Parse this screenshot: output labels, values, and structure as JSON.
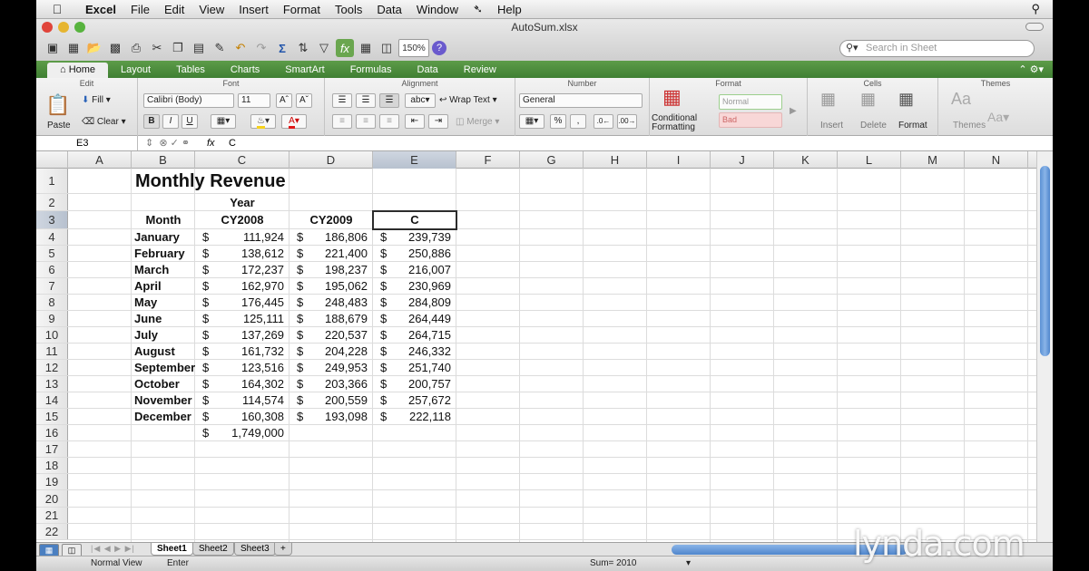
{
  "menubar": {
    "app": "Excel",
    "items": [
      "File",
      "Edit",
      "View",
      "Insert",
      "Format",
      "Tools",
      "Data",
      "Window",
      "Help"
    ]
  },
  "window": {
    "title": "AutoSum.xlsx",
    "zoom": "150%",
    "search_placeholder": "Search in Sheet"
  },
  "ribbon": {
    "tabs": [
      "Home",
      "Layout",
      "Tables",
      "Charts",
      "SmartArt",
      "Formulas",
      "Data",
      "Review"
    ],
    "groups": {
      "edit": "Edit",
      "font": "Font",
      "alignment": "Alignment",
      "number": "Number",
      "format": "Format",
      "cells": "Cells",
      "themes": "Themes"
    },
    "paste": "Paste",
    "fill": "Fill",
    "clear": "Clear",
    "font_name": "Calibri (Body)",
    "font_size": "11",
    "wrap_text": "Wrap Text",
    "merge": "Merge",
    "number_format": "General",
    "conditional": "Conditional",
    "formatting": "Formatting",
    "style_normal": "Normal",
    "style_bad": "Bad",
    "insert": "Insert",
    "delete": "Delete",
    "format_btn": "Format",
    "themes_btn": "Themes"
  },
  "formula_bar": {
    "cell_ref": "E3",
    "formula": "C"
  },
  "columns": [
    "A",
    "B",
    "C",
    "D",
    "E",
    "F",
    "G",
    "H",
    "I",
    "J",
    "K",
    "L",
    "M",
    "N"
  ],
  "rows": [
    "1",
    "2",
    "3",
    "4",
    "5",
    "6",
    "7",
    "8",
    "9",
    "10",
    "11",
    "12",
    "13",
    "14",
    "15",
    "16",
    "17",
    "18",
    "19",
    "20",
    "21",
    "22"
  ],
  "sheet": {
    "title": "Monthly Revenue",
    "year_label": "Year",
    "month_header": "Month",
    "col_headers": [
      "CY2008",
      "CY2009",
      "C"
    ],
    "currency": "$",
    "months": [
      {
        "m": "January",
        "c": "111,924",
        "d": "186,806",
        "e": "239,739"
      },
      {
        "m": "February",
        "c": "138,612",
        "d": "221,400",
        "e": "250,886"
      },
      {
        "m": "March",
        "c": "172,237",
        "d": "198,237",
        "e": "216,007"
      },
      {
        "m": "April",
        "c": "162,970",
        "d": "195,062",
        "e": "230,969"
      },
      {
        "m": "May",
        "c": "176,445",
        "d": "248,483",
        "e": "284,809"
      },
      {
        "m": "June",
        "c": "125,111",
        "d": "188,679",
        "e": "264,449"
      },
      {
        "m": "July",
        "c": "137,269",
        "d": "220,537",
        "e": "264,715"
      },
      {
        "m": "August",
        "c": "161,732",
        "d": "204,228",
        "e": "246,332"
      },
      {
        "m": "September",
        "c": "123,516",
        "d": "249,953",
        "e": "251,740"
      },
      {
        "m": "October",
        "c": "164,302",
        "d": "203,366",
        "e": "200,757"
      },
      {
        "m": "November",
        "c": "114,574",
        "d": "200,559",
        "e": "257,672"
      },
      {
        "m": "December",
        "c": "160,308",
        "d": "193,098",
        "e": "222,118"
      }
    ],
    "total_c": "1,749,000"
  },
  "sheet_tabs": [
    "Sheet1",
    "Sheet2",
    "Sheet3",
    "+"
  ],
  "status": {
    "view": "Normal View",
    "mode": "Enter",
    "sum": "Sum= 2010"
  },
  "watermark": "lynda.com",
  "colors": {
    "ribbon_tab_green": "#4f8f3f",
    "selection_blue": "#5b91d4"
  }
}
